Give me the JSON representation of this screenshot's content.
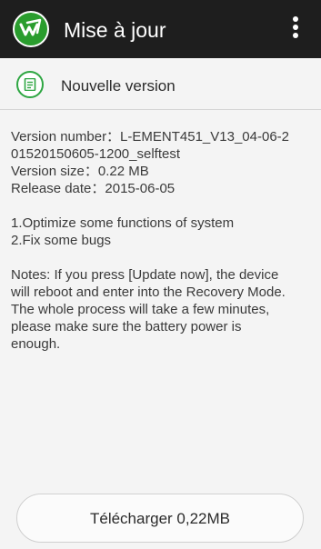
{
  "app": {
    "title": "Mise à jour",
    "icon": "app-logo-icon",
    "menu_icon": "overflow-menu-icon"
  },
  "version": {
    "icon": "document-icon",
    "label": "Nouvelle version"
  },
  "details": {
    "version_number_line1": "Version number：L-EMENT451_V13_04-06-2",
    "version_number_line2": "01520150605-1200_selftest",
    "version_size": "Version size：0.22 MB",
    "release_date": "Release date：2015-06-05"
  },
  "changes": [
    "1.Optimize some functions of system",
    "2.Fix some bugs"
  ],
  "notes": [
    "Notes: If you press [Update now], the device",
    "will reboot and enter into the Recovery Mode.",
    "The whole process will take a few minutes,",
    "please make sure the battery power is",
    "enough."
  ],
  "download_button": {
    "label": "Télécharger  0,22MB"
  },
  "colors": {
    "topbar": "#1e1e1e",
    "accent_green": "#2ea642",
    "background": "#f4f4f4"
  }
}
